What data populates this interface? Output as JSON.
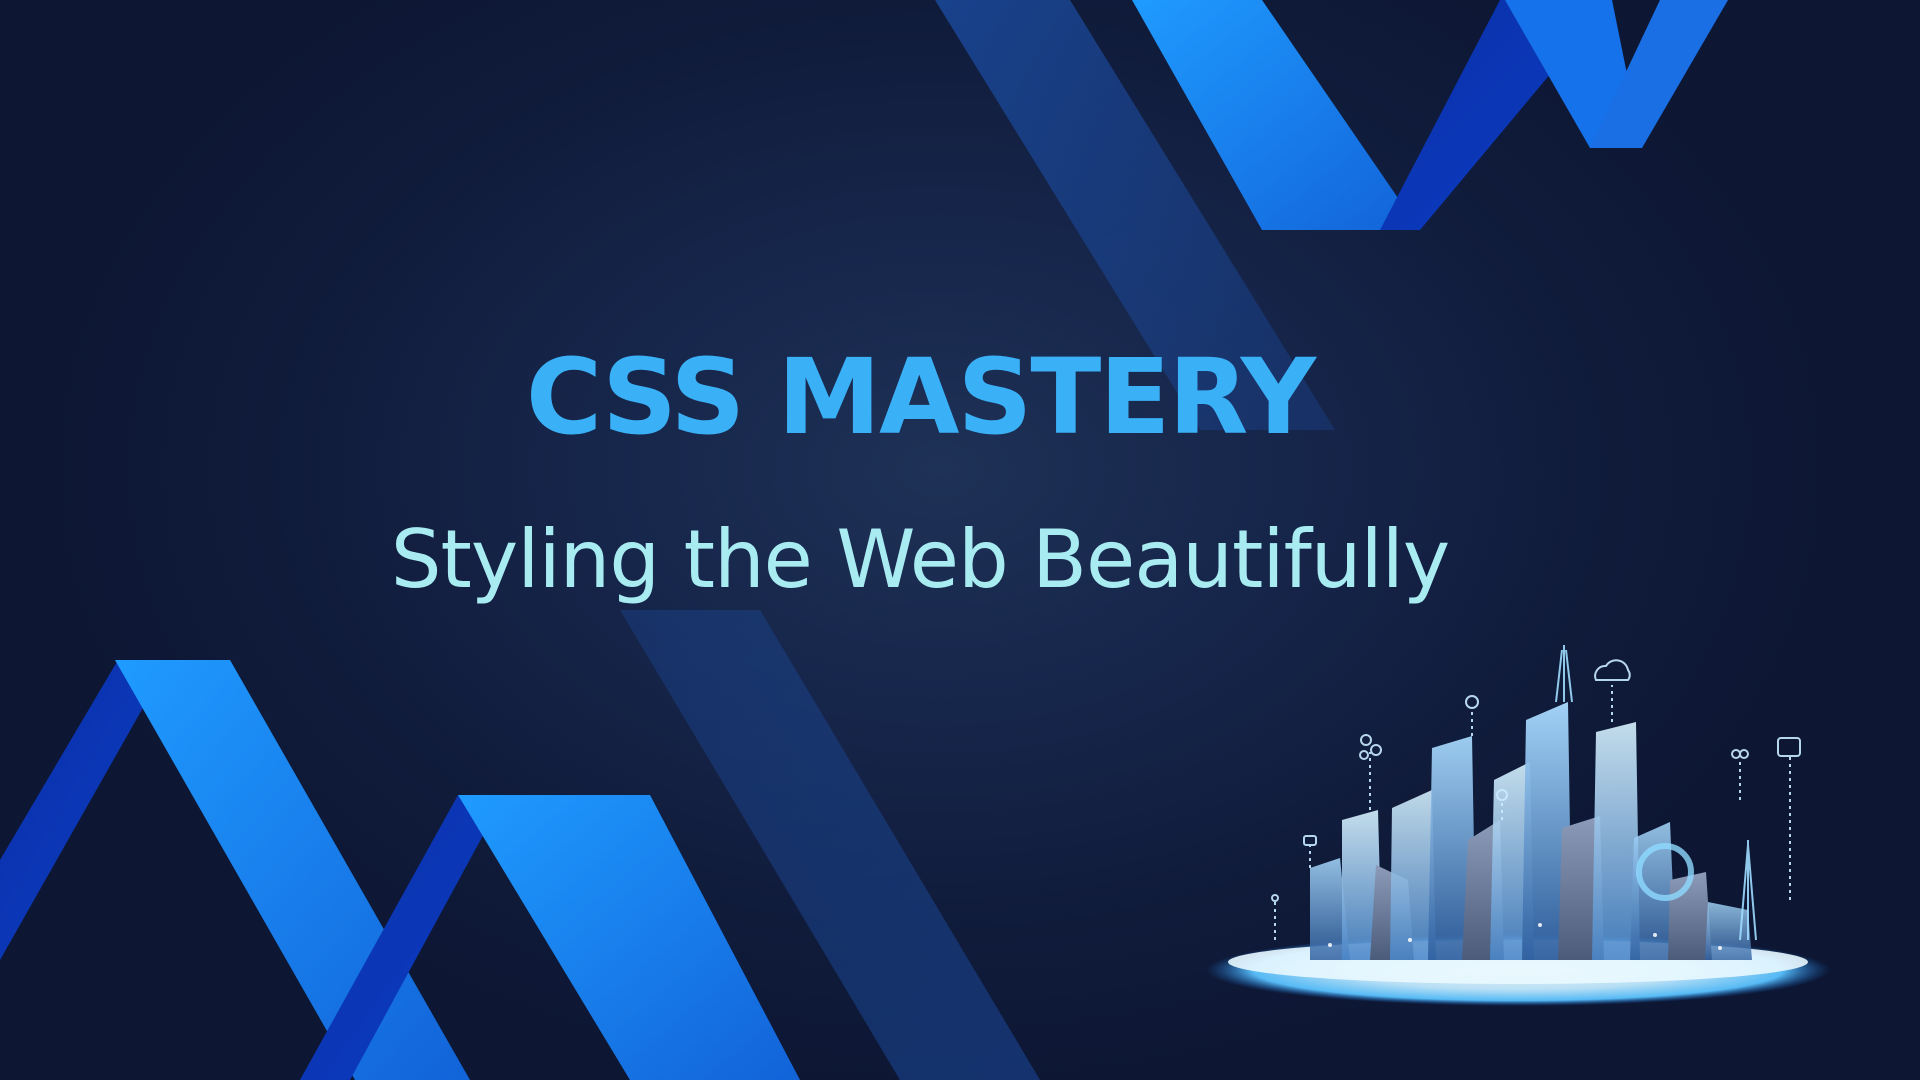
{
  "slide": {
    "title": "CSS MASTERY",
    "subtitle": "Styling the Web Beautifully",
    "illustration": "smart-city-illustration"
  },
  "colors": {
    "background": "#101b3a",
    "title": "#3ab0f7",
    "subtitle": "#a8ecf2",
    "ribbon_light": "#1a8cf5",
    "ribbon_dark": "#0a2a9e"
  }
}
